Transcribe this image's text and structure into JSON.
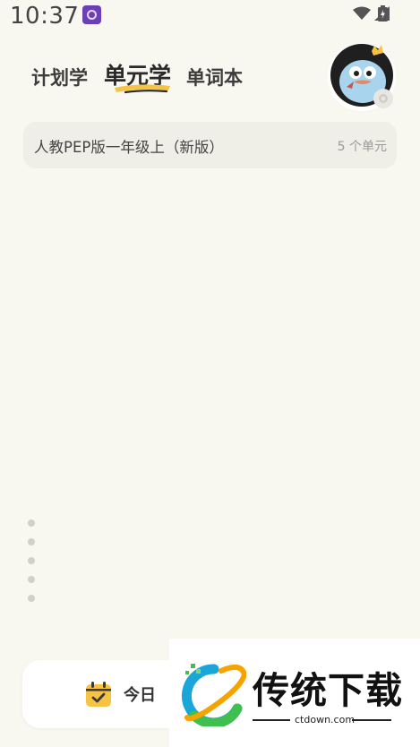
{
  "status_bar": {
    "time": "10:37"
  },
  "tabs": [
    {
      "label": "计划学",
      "active": false
    },
    {
      "label": "单元学",
      "active": true
    },
    {
      "label": "单词本",
      "active": false
    }
  ],
  "book": {
    "title": "人教PEP版一年级上（新版）",
    "unit_count": "5 个单元"
  },
  "bottom_bar": {
    "label": "今日"
  },
  "watermark": {
    "title": "传统下载",
    "domain": "ctdown.com"
  },
  "colors": {
    "background": "#f8f7f0",
    "card": "#efeee7",
    "accent_yellow": "#f6c343",
    "avatar_bird": "#a8d4ee"
  }
}
